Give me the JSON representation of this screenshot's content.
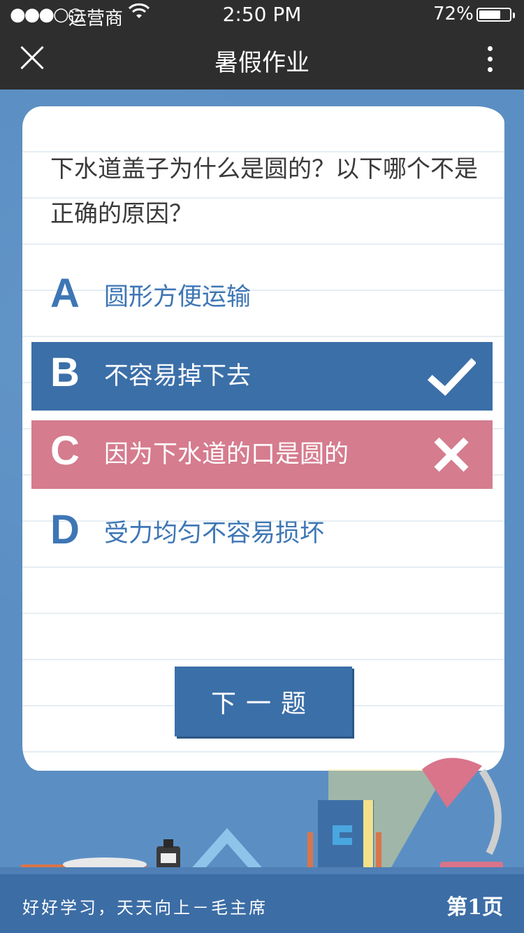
{
  "status_bar": {
    "signal": "●●●○○",
    "carrier": "运营商",
    "wifi_icon": "wifi-icon",
    "time": "2:50 PM",
    "battery": "72%",
    "battery_level": 0.72
  },
  "nav": {
    "title": "暑假作业"
  },
  "question": {
    "text": "下水道盖子为什么是圆的？以下哪个不是正确的原因？"
  },
  "options": [
    {
      "letter": "A",
      "label": "圆形方便运输",
      "state": "none"
    },
    {
      "letter": "B",
      "label": "不容易掉下去",
      "state": "correct"
    },
    {
      "letter": "C",
      "label": "因为下水道的口是圆的",
      "state": "wrong"
    },
    {
      "letter": "D",
      "label": "受力均匀不容易损坏",
      "state": "none"
    }
  ],
  "next_button": {
    "label": "下一题"
  },
  "footer": {
    "motto": "好好学习，天天向上－毛主席",
    "page": "第1页"
  },
  "colors": {
    "background": "#5b8fc4",
    "correct": "#3b6fa8",
    "wrong": "#d57c8e",
    "option_text": "#3e76b5",
    "footer": "#3c6da5"
  }
}
